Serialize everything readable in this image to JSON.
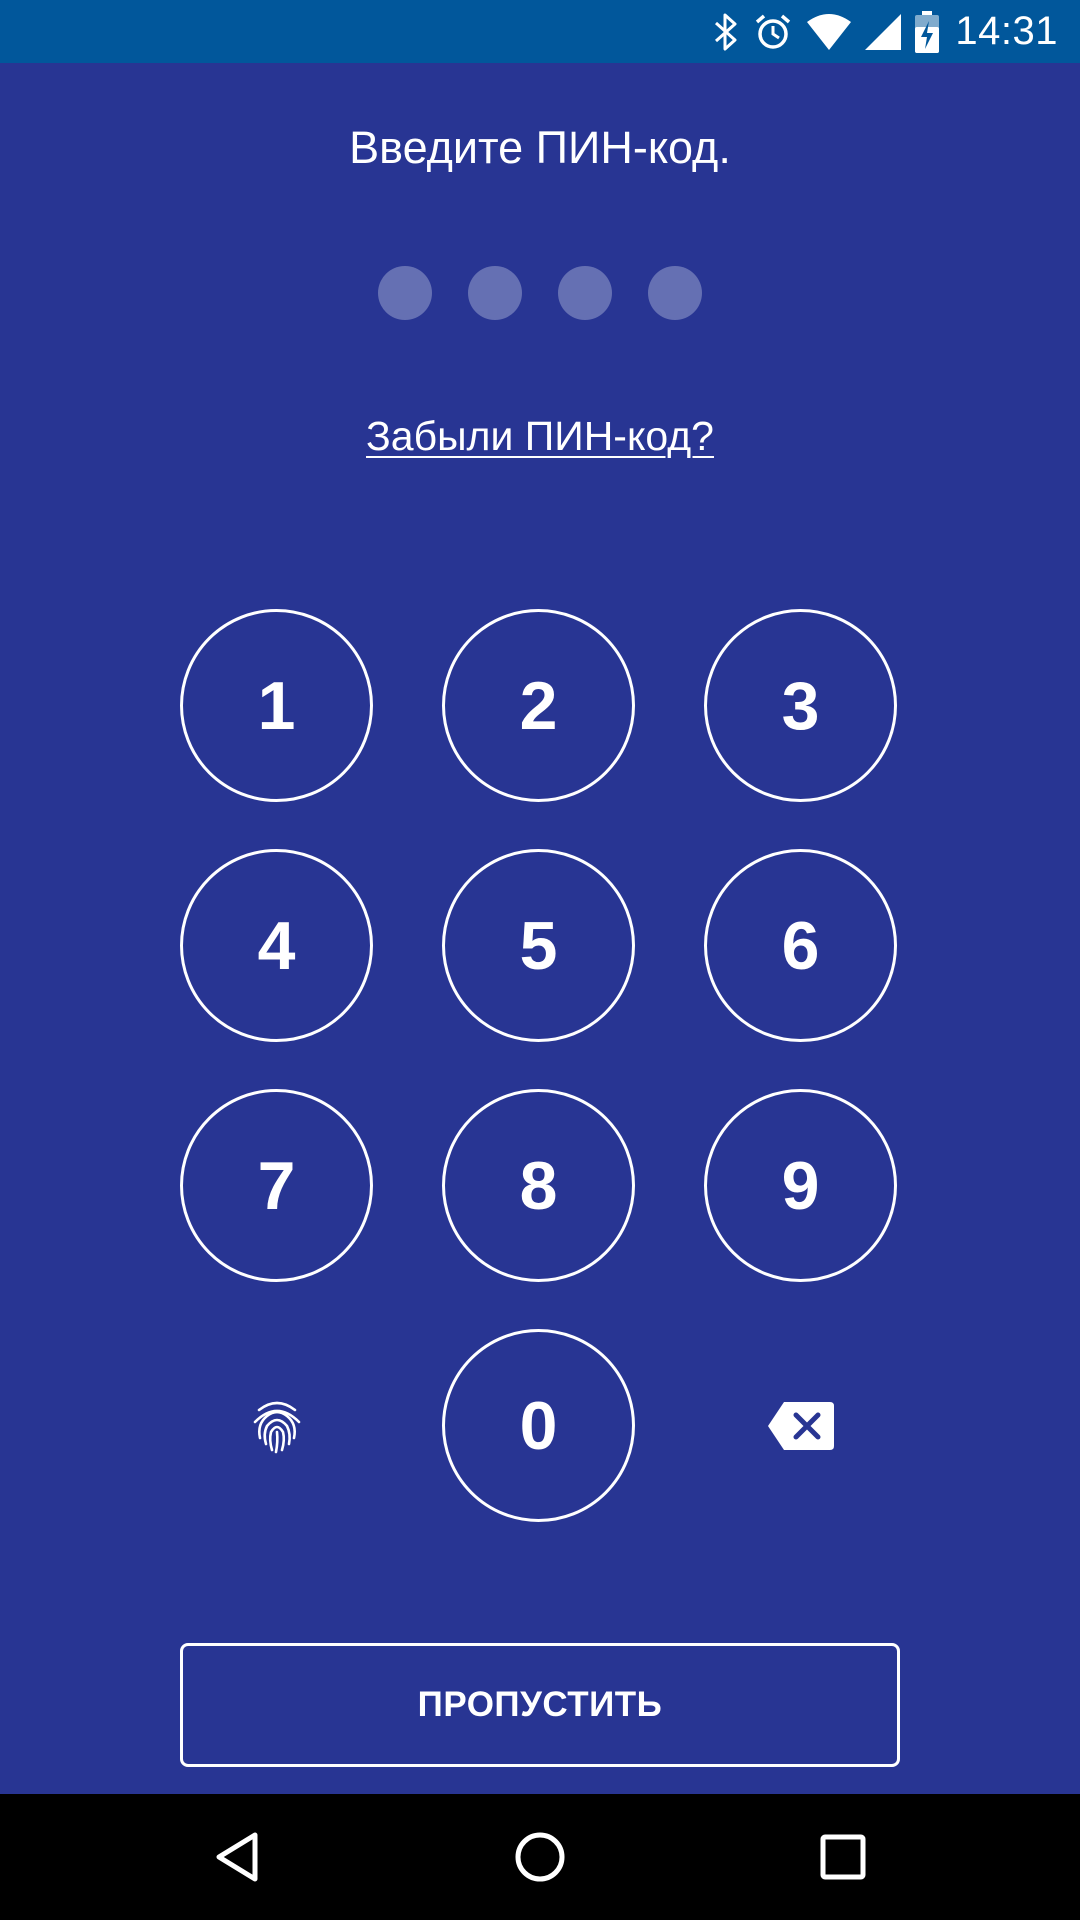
{
  "status_bar": {
    "time": "14:31",
    "icons": [
      "bluetooth-icon",
      "alarm-icon",
      "wifi-icon",
      "signal-icon",
      "battery-charging-icon"
    ],
    "background": "#01579b"
  },
  "pin_screen": {
    "title": "Введите ПИН-код.",
    "pin_length": 4,
    "entered_digits": 0,
    "forgot_link": "Забыли ПИН-код?",
    "keys": [
      "1",
      "2",
      "3",
      "4",
      "5",
      "6",
      "7",
      "8",
      "9",
      "0"
    ],
    "fingerprint_icon": "fingerprint-icon",
    "backspace_icon": "backspace-icon",
    "skip_label": "ПРОПУСТИТЬ",
    "background": "#283593",
    "dot_color": "#6570b3"
  },
  "nav_bar": {
    "icons": [
      "back-icon",
      "home-icon",
      "recents-icon"
    ]
  }
}
